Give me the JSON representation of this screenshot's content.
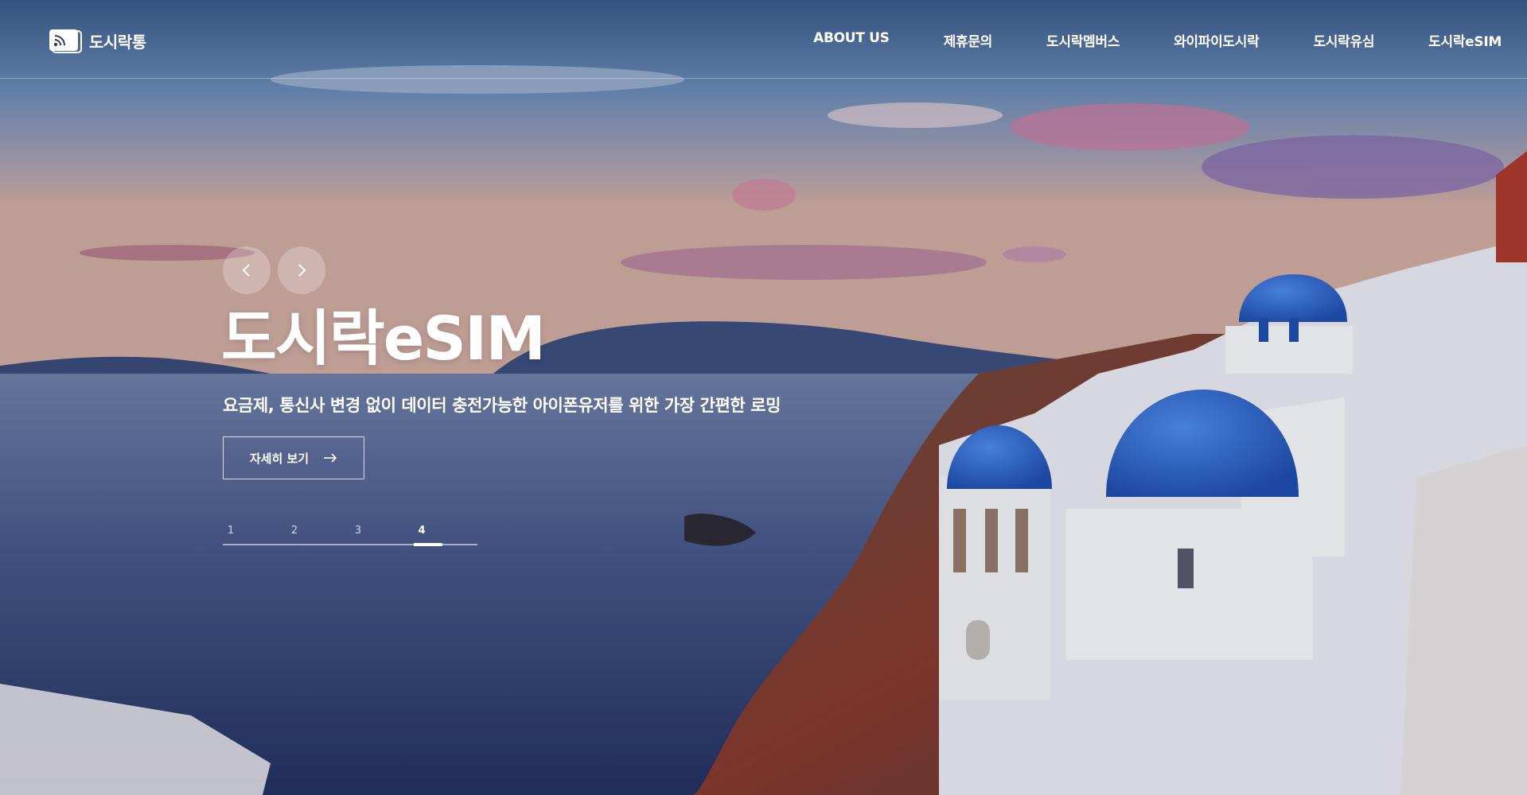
{
  "header": {
    "logo_text": "도시락통",
    "logo_icon": "wifi-router-icon",
    "nav": [
      {
        "label": "ABOUT US"
      },
      {
        "label": "제휴문의"
      },
      {
        "label": "도시락멤버스"
      },
      {
        "label": "와이파이도시락"
      },
      {
        "label": "도시락유심"
      },
      {
        "label": "도시락eSIM"
      }
    ]
  },
  "hero": {
    "prev_icon": "chevron-left-icon",
    "next_icon": "chevron-right-icon",
    "title": "도시락eSIM",
    "subtitle": "요금제, 통신사 변경 없이 데이터 충전가능한 아이폰유저를 위한 가장 간편한 로밍",
    "cta_label": "자세히 보기",
    "cta_icon": "arrow-right-icon",
    "pager": {
      "pages": [
        "1",
        "2",
        "3",
        "4"
      ],
      "active_index": 3
    }
  },
  "colors": {
    "dome_blue": "#2f6fd6",
    "sea": "#2b3b70",
    "text": "#ffffff"
  }
}
